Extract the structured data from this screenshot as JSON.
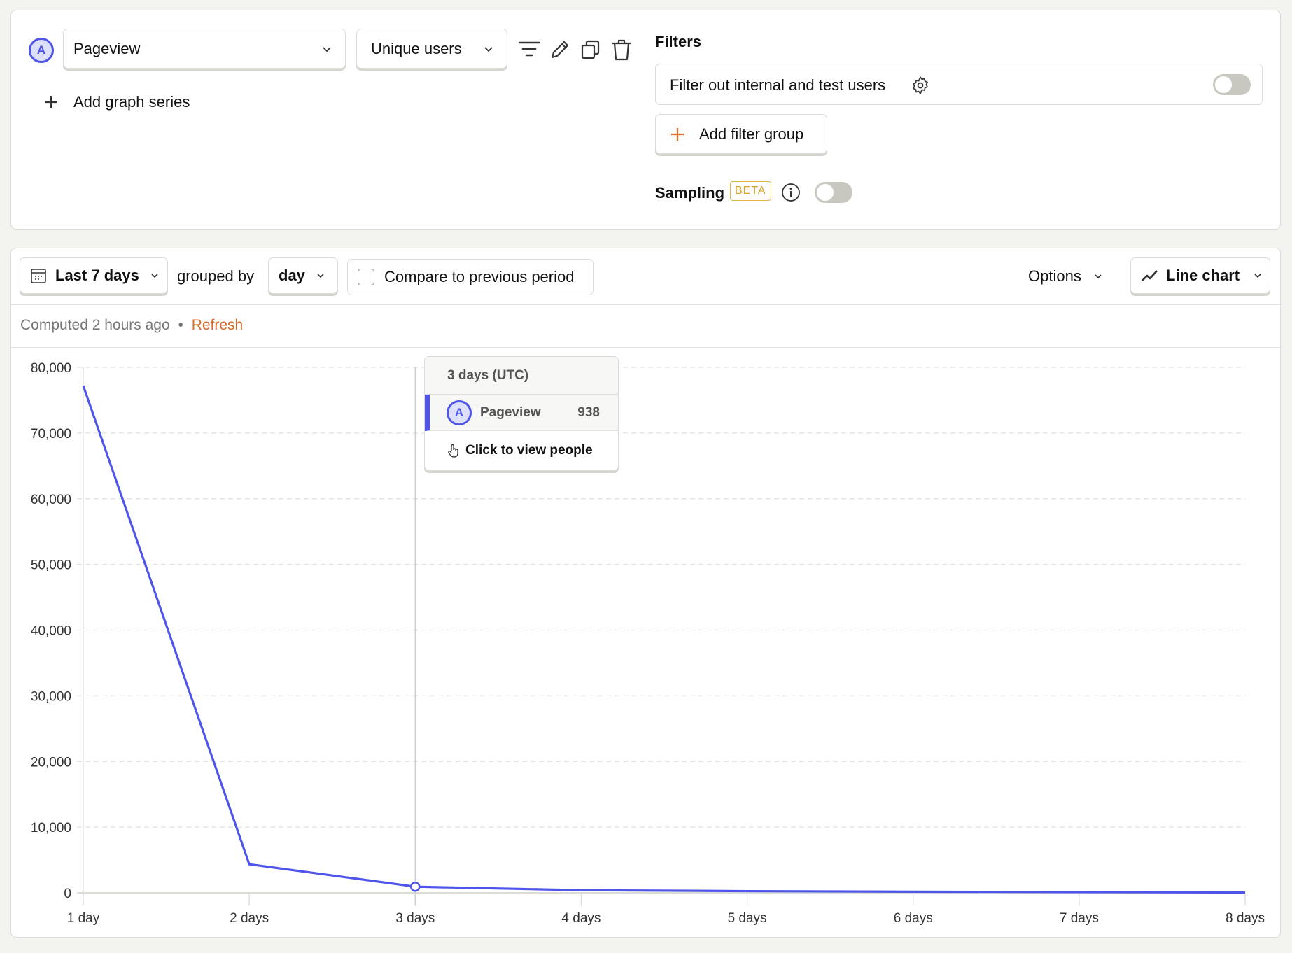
{
  "series": {
    "badge": "A",
    "event_select": "Pageview",
    "math_select": "Unique users",
    "add_series_label": "Add graph series",
    "actions": [
      "filter-icon",
      "edit-icon",
      "duplicate-icon",
      "delete-icon"
    ]
  },
  "filters": {
    "title": "Filters",
    "internal_filter_label": "Filter out internal and test users",
    "internal_filter_enabled": false,
    "add_filter_group_label": "Add filter group",
    "sampling_label": "Sampling",
    "sampling_badge": "BETA",
    "sampling_enabled": false
  },
  "toolbar": {
    "date_range": "Last 7 days",
    "grouped_by_label": "grouped by",
    "interval": "day",
    "compare_label": "Compare to previous period",
    "compare_checked": false,
    "options_label": "Options",
    "chart_type": "Line chart"
  },
  "status": {
    "computed_text": "Computed 2 hours ago",
    "separator": "•",
    "refresh_label": "Refresh"
  },
  "colors": {
    "series": "#4f55e8",
    "accent": "#e06b2b"
  },
  "tooltip": {
    "title": "3 days (UTC)",
    "series_badge": "A",
    "series_name": "Pageview",
    "value": "938",
    "footer": "Click to view people"
  },
  "chart_data": {
    "type": "line",
    "title": "",
    "xlabel": "",
    "ylabel": "",
    "categories": [
      "1 day",
      "2 days",
      "3 days",
      "4 days",
      "5 days",
      "6 days",
      "7 days",
      "8 days"
    ],
    "series": [
      {
        "name": "Pageview",
        "values": [
          77200,
          4350,
          938,
          400,
          260,
          170,
          120,
          50
        ]
      }
    ],
    "ylim": [
      0,
      80000
    ],
    "yticks": [
      0,
      10000,
      20000,
      30000,
      40000,
      50000,
      60000,
      70000,
      80000
    ],
    "ytick_labels": [
      "0",
      "10,000",
      "20,000",
      "30,000",
      "40,000",
      "50,000",
      "60,000",
      "70,000",
      "80,000"
    ],
    "grid": true,
    "highlighted_index": 2
  }
}
